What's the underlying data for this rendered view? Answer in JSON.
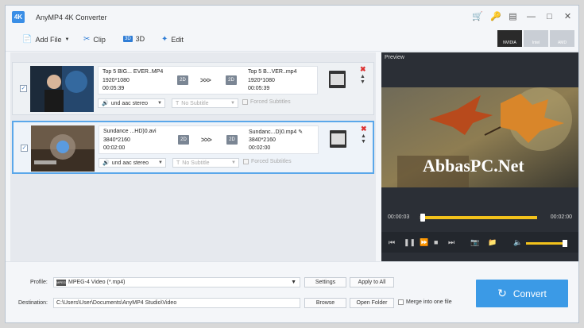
{
  "app": {
    "title": "AnyMP4 4K Converter",
    "logo_text": "4K"
  },
  "titlebar_icons": [
    "cart-icon",
    "key-icon",
    "chat-icon",
    "minimize-icon",
    "maximize-icon",
    "close-icon"
  ],
  "toolbar": {
    "add_file": "Add File",
    "clip": "Clip",
    "threed": "3D",
    "threed_badge": "3D",
    "edit": "Edit",
    "accel": [
      "NVIDIA",
      "Intel",
      "AMD"
    ]
  },
  "files": [
    {
      "name": "Top 5 BIG... EVER..MP4",
      "resolution": "1920*1080",
      "duration": "00:05:39",
      "badge_in": "2D",
      "badge_out": "2D",
      "arrows": ">>>",
      "out_name": "Top 5 B...VER..mp4",
      "out_resolution": "1920*1080",
      "out_duration": "00:05:39",
      "audio": "und aac stereo",
      "subtitle": "No Subtitle",
      "forced": "Forced Subtitles"
    },
    {
      "name": "Sundance ...HD)0.avi",
      "resolution": "3840*2160",
      "duration": "00:02:00",
      "badge_in": "2D",
      "badge_out": "2D",
      "arrows": ">>>",
      "out_name": "Sundanc...D)0.mp4",
      "out_resolution": "3840*2160",
      "out_duration": "00:02:00",
      "audio": "und aac stereo",
      "subtitle": "No Subtitle",
      "forced": "Forced Subtitles"
    }
  ],
  "preview": {
    "label": "Preview",
    "watermark": "AbbasPC.Net",
    "time_current": "00:00:03",
    "time_total": "00:02:00",
    "progress": 0.02,
    "volume": 0.9
  },
  "bottom": {
    "profile_label": "Profile:",
    "profile_value": "MPEG-4 Video (*.mp4)",
    "profile_icon_text": "MPEG",
    "settings": "Settings",
    "apply_all": "Apply to All",
    "destination_label": "Destination:",
    "destination_value": "C:\\Users\\User\\Documents\\AnyMP4 Studio\\Video",
    "browse": "Browse",
    "open_folder": "Open Folder",
    "merge": "Merge into one file",
    "convert": "Convert"
  },
  "colors": {
    "accent": "#3b9ae6",
    "progress": "#f3c21b",
    "preview_bg": "#2b2f36"
  }
}
